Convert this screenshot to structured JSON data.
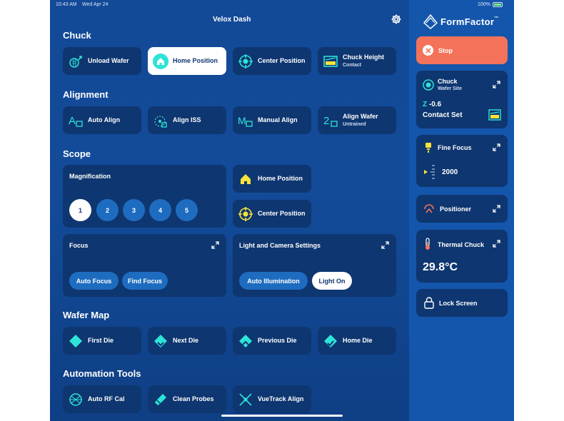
{
  "status_bar": {
    "time": "10:43 AM",
    "date": "Wed Apr 24",
    "battery": "100%"
  },
  "header": {
    "title": "Velox Dash"
  },
  "icons": {
    "settings": "gear-icon"
  },
  "colors": {
    "background": "#124a98",
    "tile": "#0e3670",
    "sidebar": "#1456ab",
    "stop": "#f4725a",
    "accent": "#2ee3d8",
    "highlight": "#f8e33c"
  },
  "chuck": {
    "heading": "Chuck",
    "unload_wafer": "Unload Wafer",
    "home_position": "Home Position",
    "center_position": "Center Position",
    "chuck_height": "Chuck Height",
    "chuck_height_sub": "Contact"
  },
  "alignment": {
    "heading": "Alignment",
    "auto_align": "Auto Align",
    "align_iss": "Align ISS",
    "manual_align": "Manual Align",
    "align_wafer": "Align Wafer",
    "align_wafer_sub": "Untrained"
  },
  "scope": {
    "heading": "Scope",
    "magnification_title": "Magnification",
    "magnification_levels": [
      "1",
      "2",
      "3",
      "4",
      "5"
    ],
    "magnification_selected": "1",
    "home_position": "Home Position",
    "center_position": "Center Position",
    "focus_title": "Focus",
    "auto_focus": "Auto Focus",
    "find_focus": "Find Focus",
    "light_title": "Light and Camera Settings",
    "auto_illumination": "Auto Illumination",
    "light_on": "Light On"
  },
  "wafer_map": {
    "heading": "Wafer Map",
    "first_die": "First Die",
    "next_die": "Next Die",
    "previous_die": "Previous Die",
    "home_die": "Home Die"
  },
  "automation": {
    "heading": "Automation Tools",
    "auto_rf_cal": "Auto RF Cal",
    "clean_probes": "Clean Probes",
    "vuetrack_align": "VueTrack Align"
  },
  "sidebar": {
    "brand": "FormFactor",
    "brand_tm": "™",
    "stop": "Stop",
    "chuck_title": "Chuck",
    "chuck_sub": "Wafer Site",
    "z_label": "Z",
    "z_value": "-0.6",
    "contact_set": "Contact Set",
    "fine_focus": "Fine Focus",
    "fine_focus_value": "2000",
    "positioner": "Positioner",
    "thermal_chuck": "Thermal Chuck",
    "thermal_value": "29.8°C",
    "lock_screen": "Lock Screen"
  }
}
